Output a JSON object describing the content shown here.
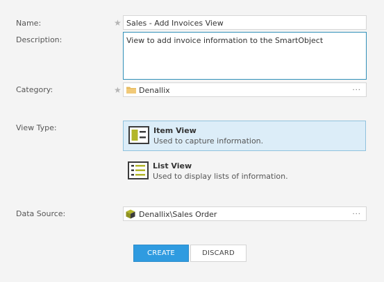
{
  "form": {
    "name": {
      "label": "Name:",
      "value": "Sales - Add Invoices View",
      "required_mark": "★"
    },
    "description": {
      "label": "Description:",
      "value": "View to add invoice information to the SmartObject"
    },
    "category": {
      "label": "Category:",
      "value": "Denallix",
      "required_mark": "★",
      "more": "···",
      "icon": "folder-icon"
    },
    "view_type": {
      "label": "View Type:",
      "options": [
        {
          "title": "Item View",
          "description": "Used to capture information.",
          "icon": "item-view-icon",
          "selected": true
        },
        {
          "title": "List View",
          "description": "Used to display lists of information.",
          "icon": "list-view-icon",
          "selected": false
        }
      ]
    },
    "data_source": {
      "label": "Data Source:",
      "value": "Denallix\\Sales Order",
      "more": "···",
      "icon": "smartobject-icon"
    }
  },
  "actions": {
    "create": "CREATE",
    "discard": "DISCARD"
  },
  "colors": {
    "primary": "#2f9be0",
    "selected_bg": "#dcedf8",
    "focus_border": "#2f8fb8",
    "folder": "#e6b95c"
  }
}
